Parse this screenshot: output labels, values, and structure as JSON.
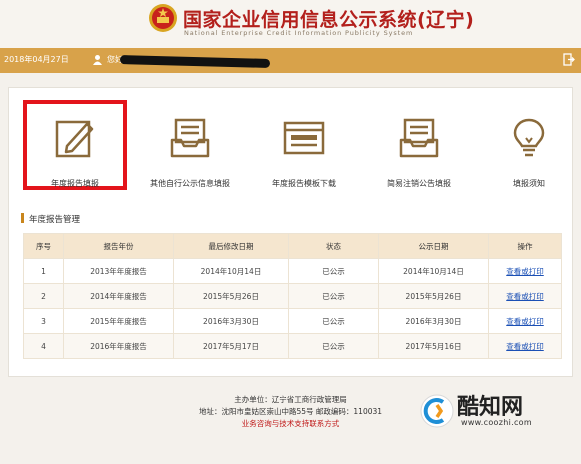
{
  "header": {
    "title": "国家企业信用信息公示系统(辽宁)",
    "subtitle": "National Enterprise Credit Information Publicity System",
    "emblem_icon": "national-emblem-icon"
  },
  "userbar": {
    "date": "2018年04月27日",
    "greeting": "您好",
    "exit_icon": "logout-icon"
  },
  "functions": [
    {
      "label": "年度报告填报",
      "icon": "edit-document-icon"
    },
    {
      "label": "其他自行公示信息填报",
      "icon": "inbox-tray-icon"
    },
    {
      "label": "年度报告模板下载",
      "icon": "template-window-icon"
    },
    {
      "label": "简易注销公告填报",
      "icon": "inbox-tray-icon"
    },
    {
      "label": "填报须知",
      "icon": "lightbulb-icon"
    }
  ],
  "section_title": "年度报告管理",
  "table": {
    "headers": [
      "序号",
      "报告年份",
      "最后修改日期",
      "状态",
      "公示日期",
      "操作"
    ],
    "rows": [
      [
        "1",
        "2013年年度报告",
        "2014年10月14日",
        "已公示",
        "2014年10月14日",
        "查看或打印"
      ],
      [
        "2",
        "2014年年度报告",
        "2015年5月26日",
        "已公示",
        "2015年5月26日",
        "查看或打印"
      ],
      [
        "3",
        "2015年年度报告",
        "2016年3月30日",
        "已公示",
        "2016年3月30日",
        "查看或打印"
      ],
      [
        "4",
        "2016年年度报告",
        "2017年5月17日",
        "已公示",
        "2017年5月16日",
        "查看或打印"
      ]
    ]
  },
  "footer": {
    "sponsor": "主办单位：辽宁省工商行政管理局",
    "address": "地址：沈阳市皇姑区崇山中路55号 邮政编码：110031",
    "support": "业务咨询与技术支持联系方式"
  },
  "watermark": {
    "name": "酷知网",
    "url": "www.coozhi.com"
  },
  "colors": {
    "userbar": "#d8a24a",
    "title_red": "#b3201c",
    "highlight": "#e3141b",
    "icon_brown": "#8a6a3b",
    "table_header": "#f5e6cf",
    "link": "#1a4fb5"
  }
}
